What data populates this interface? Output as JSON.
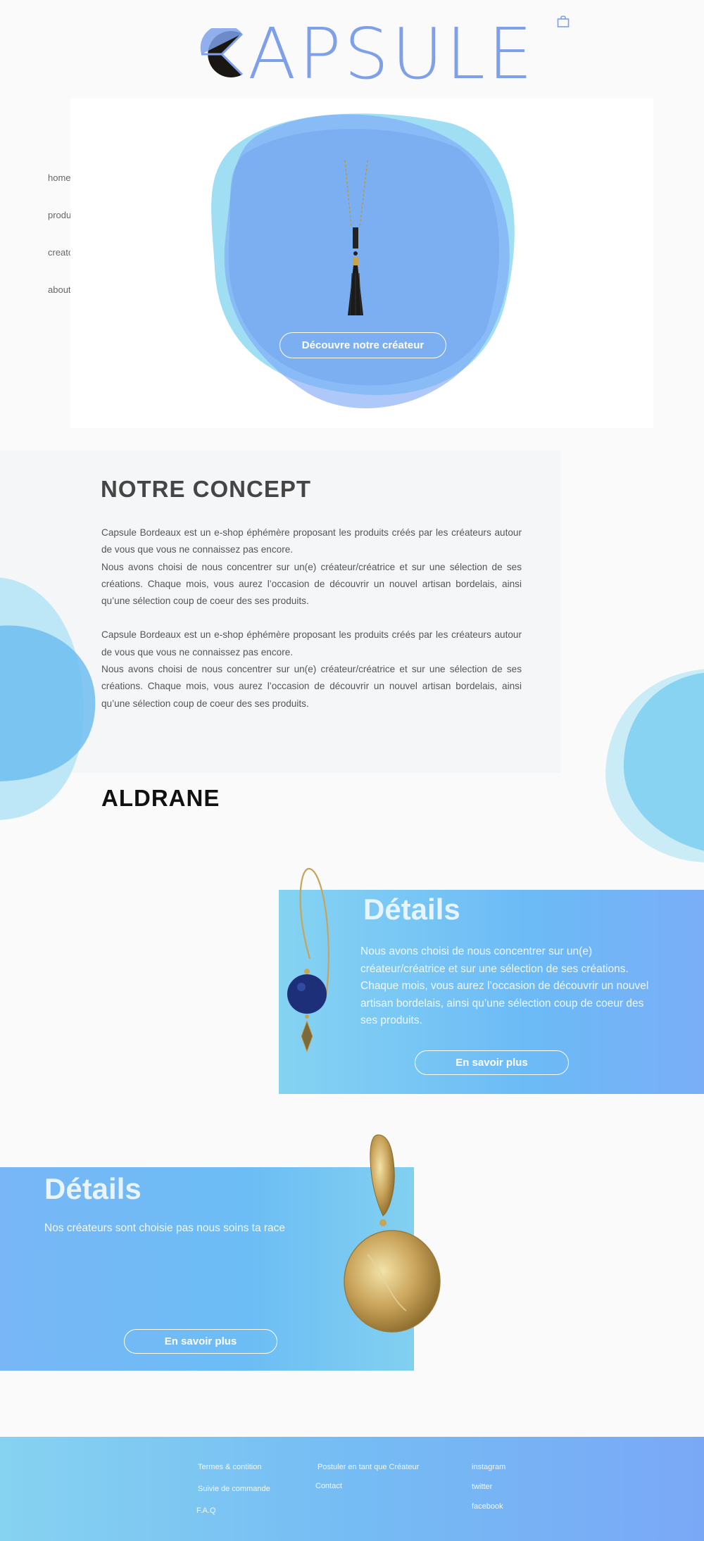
{
  "header": {
    "logo_text": "APSULE",
    "logo_full": "CAPSULE",
    "cart_icon": "shopping-bag-icon"
  },
  "nav": {
    "items": [
      {
        "label": "home"
      },
      {
        "label": "products"
      },
      {
        "label": "creators"
      },
      {
        "label": "about"
      }
    ]
  },
  "hero": {
    "button_label": "Découvre notre créateur"
  },
  "concept": {
    "title": "NOTRE CONCEPT",
    "paragraphs": [
      "Capsule Bordeaux est un e-shop éphémère proposant les produits créés par les créateurs autour de vous que vous ne connaissez pas encore.\nNous avons choisi de nous concentrer sur un(e) créateur/créatrice et sur une sélection de ses créations. Chaque mois, vous aurez l’occasion de découvrir un nouvel artisan bordelais, ainsi qu’une sélection coup de coeur des ses produits.",
      "Capsule Bordeaux est un e-shop éphémère proposant les produits créés par les créateurs autour de vous que vous ne connaissez pas encore.\nNous avons choisi de nous concentrer sur un(e) créateur/créatrice et sur une sélection de ses créations. Chaque mois, vous aurez l’occasion de découvrir un nouvel artisan bordelais, ainsi qu’une sélection coup de coeur des ses produits."
    ]
  },
  "creator": {
    "name": "ALDRANE"
  },
  "details_1": {
    "title": "Détails",
    "text": "Nous avons choisi de nous concentrer sur un(e) créateur/créatrice et sur une sélection de ses créations. Chaque mois, vous aurez l’occasion de découvrir un nouvel artisan bordelais, ainsi qu’une sélection coup de coeur des ses produits.",
    "button_label": "En savoir plus"
  },
  "details_2": {
    "title": "Détails",
    "text": "Nos créateurs sont choisie pas nous soins ta race",
    "button_label": "En savoir plus"
  },
  "footer": {
    "col1": [
      "Termes & contition",
      "Suivie de commande",
      "F.A.Q"
    ],
    "col2": [
      "Postuler en tant que Créateur",
      "Contact"
    ],
    "col3": [
      "instagram",
      "twitter",
      "facebook"
    ]
  },
  "colors": {
    "brand_blue": "#7ea0ea",
    "card_gradient_start": "#85d3f2",
    "card_gradient_end": "#7aaef7"
  }
}
